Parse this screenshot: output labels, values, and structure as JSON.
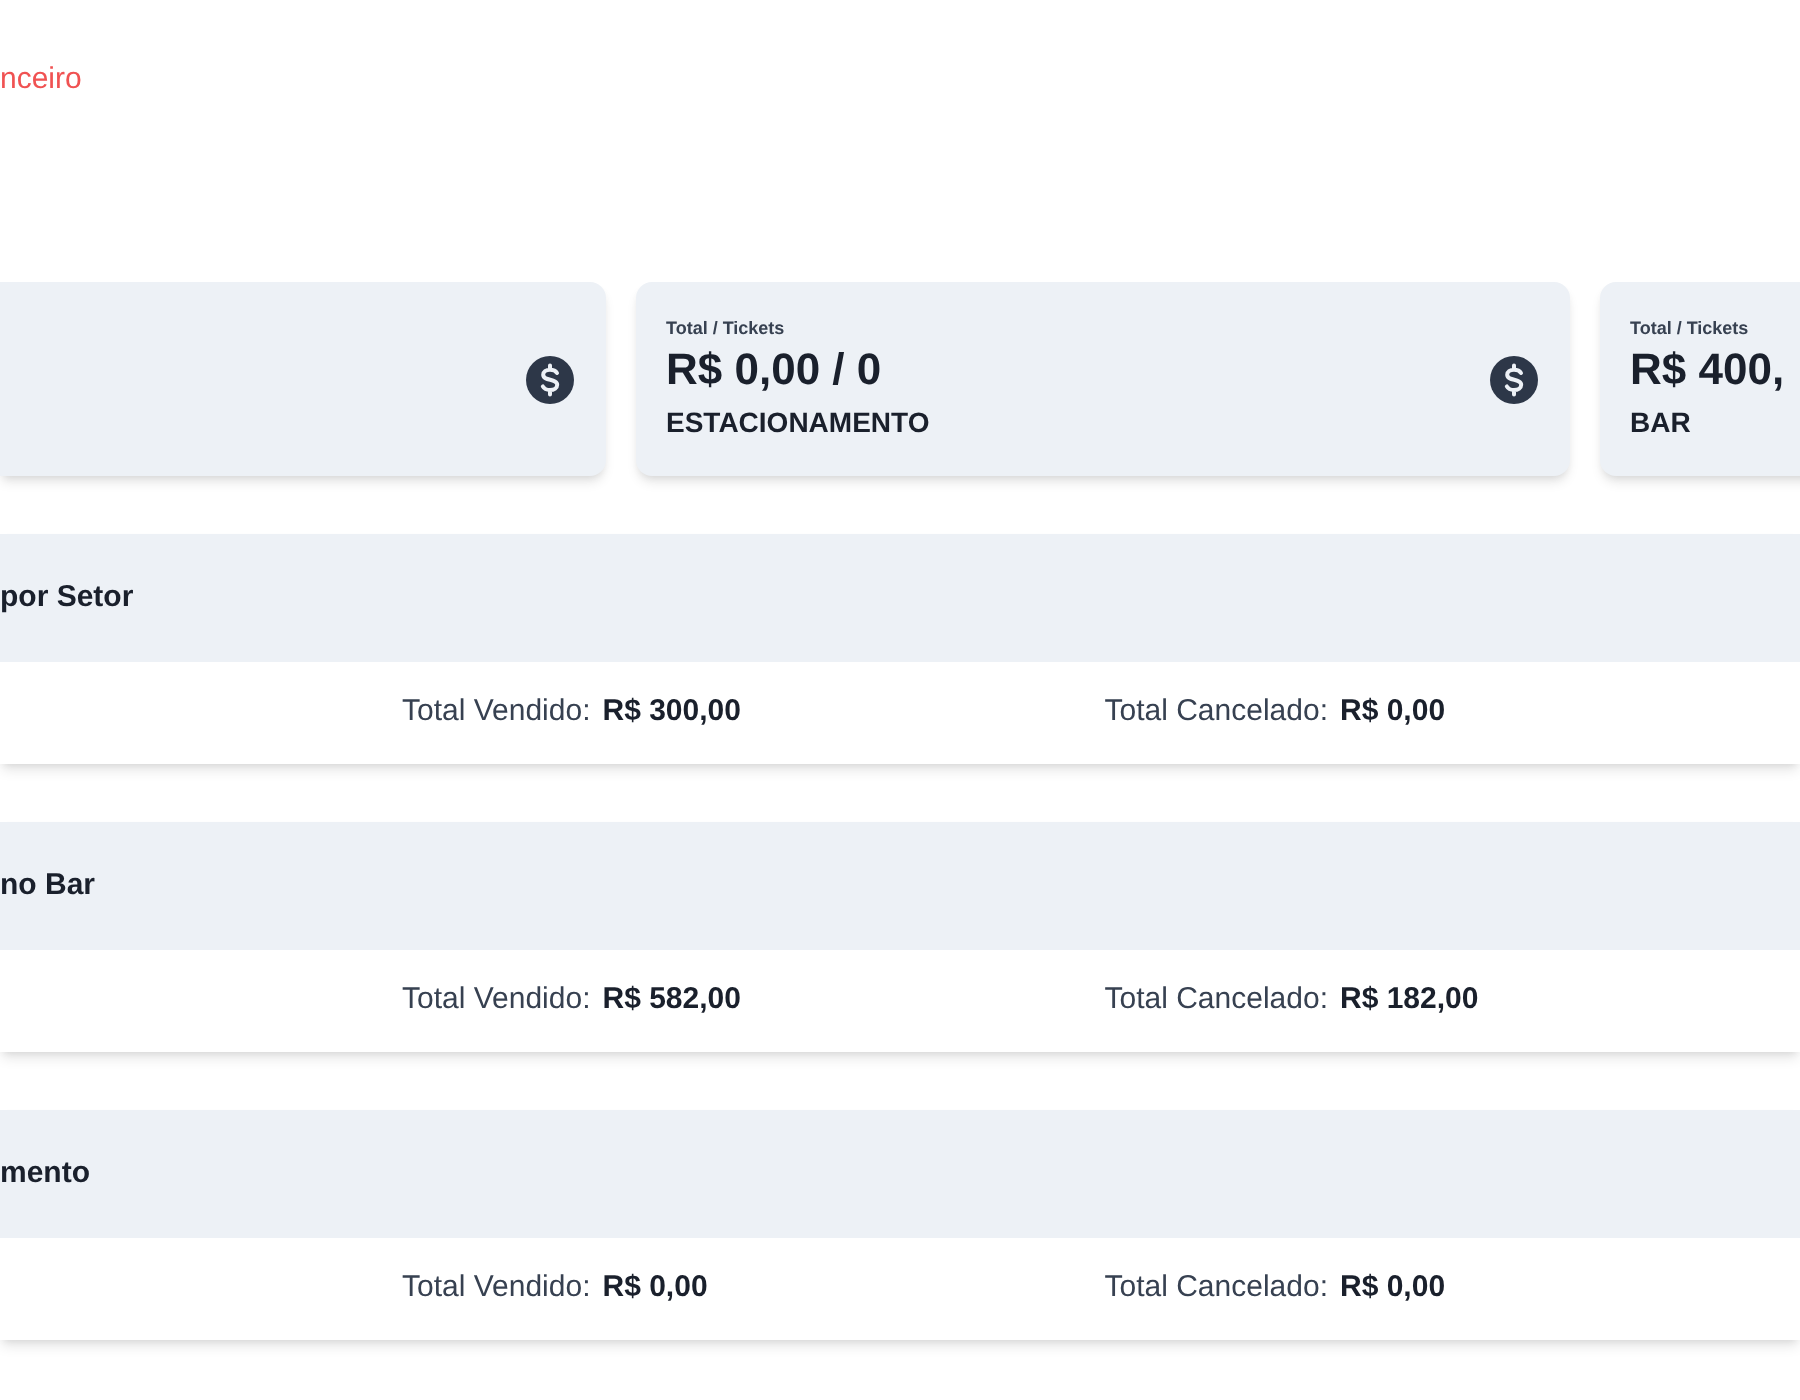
{
  "breadcrumb": "nceiro",
  "cards": [
    {
      "icon": true
    },
    {
      "caption": "Total / Tickets",
      "value": "R$ 0,00 / 0",
      "label": "ESTACIONAMENTO",
      "icon": true
    },
    {
      "caption": "Total / Tickets",
      "value": "R$ 400,",
      "label": "BAR",
      "icon": false
    }
  ],
  "sections": [
    {
      "title": "por Setor",
      "sold_label": "Total Vendido:",
      "sold": "R$ 300,00",
      "cancel_label": "Total Cancelado:",
      "cancel": "R$ 0,00"
    },
    {
      "title": "no Bar",
      "sold_label": "Total Vendido:",
      "sold": "R$ 582,00",
      "cancel_label": "Total Cancelado:",
      "cancel": "R$ 182,00"
    },
    {
      "title": "mento",
      "sold_label": "Total Vendido:",
      "sold": "R$ 0,00",
      "cancel_label": "Total Cancelado:",
      "cancel": "R$ 0,00"
    }
  ]
}
